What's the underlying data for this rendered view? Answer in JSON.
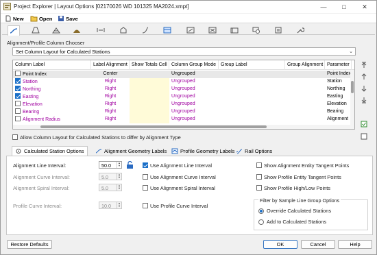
{
  "window": {
    "title": "Project Explorer | Layout Options [02170026 WD 101325 MA2024.xmpt]",
    "minimize_glyph": "—",
    "maximize_glyph": "□",
    "close_glyph": "✕"
  },
  "toolbar": {
    "new_label": "New",
    "open_label": "Open",
    "save_label": "Save"
  },
  "top_tabs": [
    "alignment-tab",
    "corridor-tab",
    "surface-tab",
    "profile-tab",
    "section-tab",
    "parcel-tab",
    "pipe-tab",
    "table-tab",
    "label-tab",
    "point-tab",
    "survey-tab",
    "report-tab",
    "settings-tab"
  ],
  "column_chooser": {
    "group_label": "Alignment/Profile Column Chooser",
    "layout_combo": "Set Column Layout for Calculated Stations",
    "headers": [
      "Column Label",
      "Label Alignment",
      "Show Totals Cell",
      "Column Group Mode",
      "Group Label",
      "Group Alignment",
      "Parameter"
    ],
    "rows": [
      {
        "checked": false,
        "label": "Point Index",
        "align": "Center",
        "mode": "Ungrouped",
        "param": "Point Index",
        "highlight": true
      },
      {
        "checked": true,
        "label": "Station",
        "align": "Right",
        "mode": "Ungrouped",
        "param": "Station"
      },
      {
        "checked": true,
        "label": "Northing",
        "align": "Right",
        "mode": "Ungrouped",
        "param": "Northing"
      },
      {
        "checked": true,
        "label": "Easting",
        "align": "Right",
        "mode": "Ungrouped",
        "param": "Easting"
      },
      {
        "checked": false,
        "label": "Elevation",
        "align": "Right",
        "mode": "Ungrouped",
        "param": "Elevation"
      },
      {
        "checked": false,
        "label": "Bearing",
        "align": "Right",
        "mode": "Ungrouped",
        "param": "Bearing"
      },
      {
        "checked": false,
        "label": "Alignment Radius",
        "align": "Right",
        "mode": "Ungrouped",
        "param": "Alignment"
      }
    ],
    "allow_differ_label": "Allow Column Layout for Calculated Stations to differ by Alignment Type"
  },
  "bottom_tabs": {
    "calc": "Calculated Station Options",
    "align_geo": "Alignment Geometry Labels",
    "prof_geo": "Profile Geometry Labels",
    "rail": "Rail Options"
  },
  "calc_options": {
    "alignment_line_interval_label": "Alignment Line Interval:",
    "alignment_line_interval_value": "50.0",
    "alignment_curve_interval_label": "Alignment Curve Interval:",
    "alignment_curve_interval_value": "5.0",
    "alignment_spiral_interval_label": "Alignment Spiral Interval:",
    "alignment_spiral_interval_value": "5.0",
    "profile_curve_interval_label": "Profile Curve Interval:",
    "profile_curve_interval_value": "10.0",
    "use_alignment_line": "Use Alignment Line Interval",
    "use_alignment_curve": "Use Alignment Curve Interval",
    "use_alignment_spiral": "Use Alignment Spiral Interval",
    "use_profile_curve": "Use Profile Curve Interval",
    "show_entity_tangent": "Show Alignment Entity Tangent Points",
    "show_profile_tangent": "Show Profile Entity Tangent Points",
    "show_high_low": "Show Profile High/Low Points",
    "filter_group_title": "Filter by Sample Line Group Options",
    "override_label": "Override Calculated Stations",
    "add_label": "Add to Calculated Stations"
  },
  "footer": {
    "restore": "Restore Defaults",
    "ok": "OK",
    "cancel": "Cancel",
    "help": "Help"
  },
  "colors": {
    "accent": "#1a6fc8",
    "row_text": "#a000a0",
    "totals_cell": "#fffbd8",
    "highlight_row": "#e8e8e8"
  }
}
